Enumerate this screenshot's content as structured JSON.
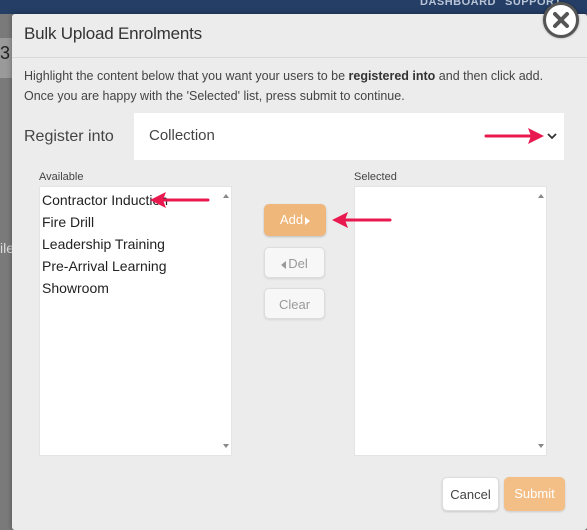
{
  "background": {
    "top_items": [
      "DASHBOARD",
      "SUPPORT"
    ],
    "left_fragment_a": "3",
    "left_fragment_b": "ile"
  },
  "modal": {
    "title": "Bulk Upload Enrolments",
    "close_icon": "close-icon",
    "instructions_before": "Highlight the content below that you want your users to be ",
    "instructions_bold": "registered into",
    "instructions_after": " and then click add. Once you are happy with the 'Selected' list, press submit to continue.",
    "register_label": "Register into",
    "register_value": "Collection",
    "available_label": "Available",
    "selected_label": "Selected",
    "available_items": [
      "Contractor Induction",
      "Fire Drill",
      "Leadership Training",
      "Pre-Arrival Learning",
      "Showroom"
    ],
    "selected_items": [],
    "add_label": "Add",
    "del_label": "Del",
    "clear_label": "Clear",
    "cancel_label": "Cancel",
    "submit_label": "Submit"
  },
  "colors": {
    "accent_orange": "#f0b77a",
    "annotation_pink": "#e8194f",
    "top_bar": "#243e66"
  }
}
